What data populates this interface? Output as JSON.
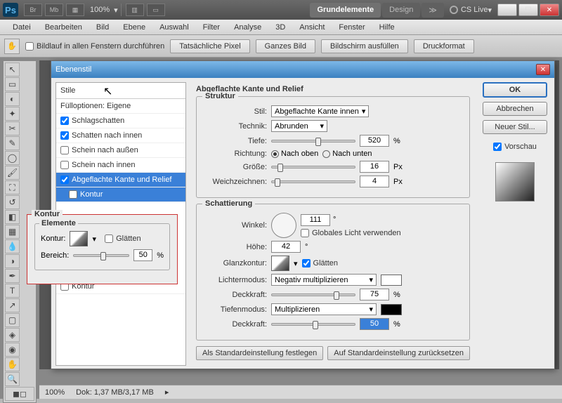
{
  "titlebar": {
    "ps": "Ps",
    "br": "Br",
    "mb": "Mb",
    "zoom": "100%",
    "ws_active": "Grundelemente",
    "ws_inactive": "Design",
    "cslive": "CS Live"
  },
  "menu": [
    "Datei",
    "Bearbeiten",
    "Bild",
    "Ebene",
    "Auswahl",
    "Filter",
    "Analyse",
    "3D",
    "Ansicht",
    "Fenster",
    "Hilfe"
  ],
  "optbar": {
    "scroll_all": "Bildlauf in allen Fenstern durchführen",
    "b1": "Tatsächliche Pixel",
    "b2": "Ganzes Bild",
    "b3": "Bildschirm ausfüllen",
    "b4": "Druckformat"
  },
  "status": {
    "zoom": "100%",
    "doc": "Dok: 1,37 MB/3,17 MB"
  },
  "dialog": {
    "title": "Ebenenstil",
    "styles_hdr": "Stile",
    "fill_opts": "Fülloptionen: Eigene",
    "s1": "Schlagschatten",
    "s2": "Schatten nach innen",
    "s3": "Schein nach außen",
    "s4": "Schein nach innen",
    "s5": "Abgeflachte Kante und Relief",
    "s5a": "Kontur",
    "s5b": "Kontur",
    "panel_title": "Abgeflachte Kante und Relief",
    "struct": "Struktur",
    "stil": "Stil:",
    "stil_v": "Abgeflachte Kante innen",
    "technik": "Technik:",
    "technik_v": "Abrunden",
    "tiefe": "Tiefe:",
    "tiefe_v": "520",
    "pct": "%",
    "richtung": "Richtung:",
    "r1": "Nach oben",
    "r2": "Nach unten",
    "groesse": "Größe:",
    "groesse_v": "16",
    "px": "Px",
    "weich": "Weichzeichnen:",
    "weich_v": "4",
    "schatt": "Schattierung",
    "winkel": "Winkel:",
    "winkel_v": "111",
    "deg": "°",
    "global": "Globales Licht verwenden",
    "hoehe": "Höhe:",
    "hoehe_v": "42",
    "glanz": "Glanzkontur:",
    "glaetten": "Glätten",
    "lichter": "Lichtermodus:",
    "lichter_v": "Negativ multiplizieren",
    "deck": "Deckkraft:",
    "deck1_v": "75",
    "tiefen": "Tiefenmodus:",
    "tiefen_v": "Multiplizieren",
    "deck2_v": "50",
    "btm1": "Als Standardeinstellung festlegen",
    "btm2": "Auf Standardeinstellung zurücksetzen",
    "ok": "OK",
    "cancel": "Abbrechen",
    "newstyle": "Neuer Stil...",
    "preview": "Vorschau"
  },
  "popout": {
    "title": "Kontur",
    "elements": "Elemente",
    "kontur": "Kontur:",
    "glaetten": "Glätten",
    "bereich": "Bereich:",
    "bereich_v": "50",
    "pct": "%"
  },
  "chart_data": {
    "type": "table",
    "note": "UI dialog, no chart"
  }
}
